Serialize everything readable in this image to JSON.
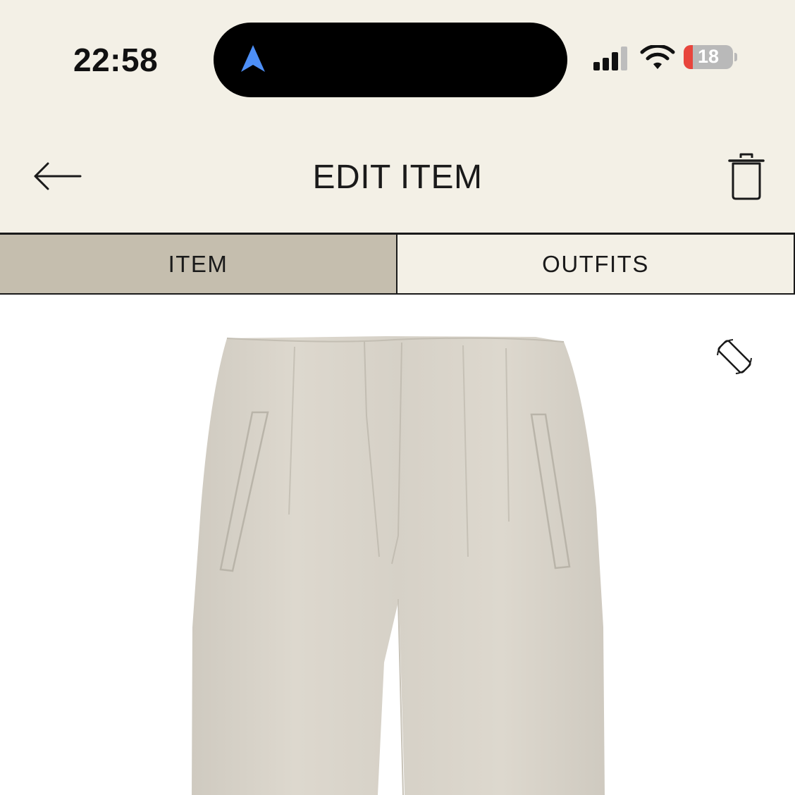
{
  "status_bar": {
    "time": "22:58",
    "battery_level": "18",
    "icons": [
      "navigation-arrow-icon",
      "cellular-signal-icon",
      "wifi-icon",
      "battery-icon"
    ]
  },
  "header": {
    "title": "EDIT ITEM",
    "back_icon": "arrow-left-icon",
    "delete_icon": "trash-icon"
  },
  "tabs": [
    {
      "label": "ITEM",
      "active": true
    },
    {
      "label": "OUTFITS",
      "active": false
    }
  ],
  "item": {
    "image_icon": "rotate-icon"
  },
  "colors": {
    "header_bg": "#f3f0e6",
    "active_tab_bg": "#c5beae",
    "accent_blue": "#4d8ff7",
    "battery_red": "#e8453c",
    "garment": "#dcd7cd"
  }
}
